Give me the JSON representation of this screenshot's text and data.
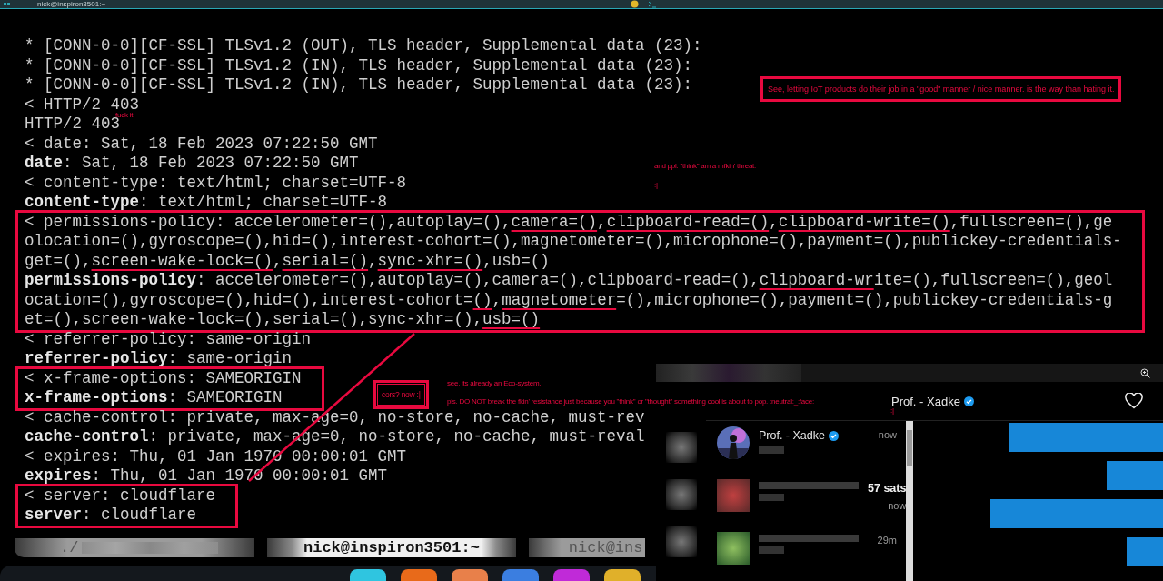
{
  "window": {
    "title": "nick@inspiron3501:~"
  },
  "terminal": {
    "blocks": [
      {
        "boxed": false,
        "lines": [
          [
            {
              "text": "* [CONN-0-0][CF-SSL] TLSv1.2 (OUT), TLS header, Supplemental data (23):",
              "kind": "plain"
            }
          ],
          [
            {
              "text": "* [CONN-0-0][CF-SSL] TLSv1.2 (IN), TLS header, Supplemental data (23):",
              "kind": "plain"
            }
          ],
          [
            {
              "text": "* [CONN-0-0][CF-SSL] TLSv1.2 (IN), TLS header, Supplemental data (23):",
              "kind": "plain"
            }
          ],
          [
            {
              "text": "< HTTP/2 403",
              "kind": "plain"
            }
          ],
          [
            {
              "text": "HTTP/2 403",
              "kind": "plain"
            }
          ],
          [
            {
              "text": "< date: Sat, 18 Feb 2023 07:22:50 GMT",
              "kind": "plain"
            }
          ],
          [
            {
              "text": "date",
              "kind": "bold"
            },
            {
              "text": ": Sat, 18 Feb 2023 07:22:50 GMT",
              "kind": "plain"
            }
          ],
          [
            {
              "text": "< content-type: text/html; charset=UTF-8",
              "kind": "plain"
            }
          ],
          [
            {
              "text": "content-type",
              "kind": "bold"
            },
            {
              "text": ": text/html; charset=UTF-8",
              "kind": "plain"
            }
          ]
        ]
      },
      {
        "boxed": true,
        "lines": [
          [
            {
              "text": "< permissions-policy: accelerometer=(),autoplay=(),",
              "kind": "plain"
            },
            {
              "text": "camera=()",
              "kind": "underlined"
            },
            {
              "text": ",",
              "kind": "plain"
            },
            {
              "text": "clipboard-read=()",
              "kind": "underlined"
            },
            {
              "text": ",",
              "kind": "plain"
            },
            {
              "text": "clipboard-write=()",
              "kind": "underlined"
            },
            {
              "text": ",fullscreen=(),geolocation=(),gyroscope=(),hid=(),interest-cohort=(),magnetometer=(),microphone=(),payment=(),publickey-credentials-get=(),",
              "kind": "plain"
            },
            {
              "text": "screen-wake-lock=()",
              "kind": "underlined"
            },
            {
              "text": ",",
              "kind": "plain"
            },
            {
              "text": "serial=()",
              "kind": "underlined"
            },
            {
              "text": ",",
              "kind": "plain"
            },
            {
              "text": "sync-xhr=()",
              "kind": "underlined"
            },
            {
              "text": ",usb=()",
              "kind": "plain"
            }
          ],
          [
            {
              "text": "permissions-policy",
              "kind": "bold"
            },
            {
              "text": ": accelerometer=(),autoplay=(),camera=(),clipboard-read=(),",
              "kind": "plain"
            },
            {
              "text": "clipboard-wr",
              "kind": "underlined"
            },
            {
              "text": "ite=(),fullscreen=(),geolocation=(),gyroscope=(),hid=(),interest-cohort=",
              "kind": "plain"
            },
            {
              "text": "()",
              "kind": "underlined"
            },
            {
              "text": ",",
              "kind": "plain"
            },
            {
              "text": "magnetometer",
              "kind": "underlined"
            },
            {
              "text": "=(),microphone=(),payment=(),publickey-credentials-get=(),screen-wake-lock=(),serial=(),sync-xhr=(),",
              "kind": "plain"
            },
            {
              "text": "usb=()",
              "kind": "underlined"
            }
          ]
        ]
      },
      {
        "boxed": false,
        "lines": [
          [
            {
              "text": "< referrer-policy: same-origin",
              "kind": "plain"
            }
          ],
          [
            {
              "text": "referrer-policy",
              "kind": "bold"
            },
            {
              "text": ": same-origin",
              "kind": "plain"
            }
          ]
        ]
      },
      {
        "boxed": true,
        "lines": [
          [
            {
              "text": "< x-frame-options: SAMEORIGIN",
              "kind": "plain"
            }
          ],
          [
            {
              "text": "x-frame-options",
              "kind": "bold"
            },
            {
              "text": ": SAMEORIGIN",
              "kind": "plain"
            }
          ]
        ]
      },
      {
        "boxed": false,
        "lines": [
          [
            {
              "text": "< cache-control: private, max-age=0, no-store, no-cache, must-rev",
              "kind": "plain"
            }
          ],
          [
            {
              "text": "cache-control",
              "kind": "bold"
            },
            {
              "text": ": private, max-age=0, no-store, no-cache, must-reval",
              "kind": "plain"
            }
          ],
          [
            {
              "text": "< expires: Thu, 01 Jan 1970 00:00:01 GMT",
              "kind": "plain"
            }
          ],
          [
            {
              "text": "expires",
              "kind": "bold"
            },
            {
              "text": ": Thu, 01 Jan 1970 00:00:01 GMT",
              "kind": "plain"
            }
          ]
        ]
      },
      {
        "boxed": true,
        "lines": [
          [
            {
              "text": "< server: cloudflare",
              "kind": "plain"
            }
          ],
          [
            {
              "text": "server",
              "kind": "bold"
            },
            {
              "text": ": cloudflare",
              "kind": "plain"
            }
          ]
        ]
      }
    ]
  },
  "tabs": [
    {
      "label": "./",
      "selected": false
    },
    {
      "label": "nick@inspiron3501:~",
      "selected": true
    },
    {
      "label": "nick@ins",
      "selected": false
    }
  ],
  "chat_window": {
    "header": {
      "name": "Prof. - Xadke",
      "verified": true
    },
    "conversations": [
      {
        "name": "Prof. - Xadke",
        "verified": true,
        "time": "now"
      },
      {
        "amount": "57 sats",
        "time": "now"
      },
      {
        "time": "29m"
      }
    ]
  },
  "annotations": [
    {
      "text": "See, letting IoT products do their job in a \"good\" manner / nice manner. is the way than hating it.",
      "kind": "boxed"
    },
    {
      "text": "fuck it.",
      "kind": "note"
    },
    {
      "text": "and ppl. \"think\" am a mfkin' threat.",
      "kind": "note"
    },
    {
      "text": ":|",
      "kind": "note"
    },
    {
      "text": "cors? now :|",
      "kind": "double-boxed"
    },
    {
      "text": "see, its already an Eco-system.",
      "kind": "note"
    },
    {
      "text": "pls. DO NOT break the fkin' resistance just because you \"think\" or \"thought\" something cool is about to pop. :neutral:_:face:",
      "kind": "note"
    },
    {
      "text": ":|",
      "kind": "note"
    }
  ]
}
